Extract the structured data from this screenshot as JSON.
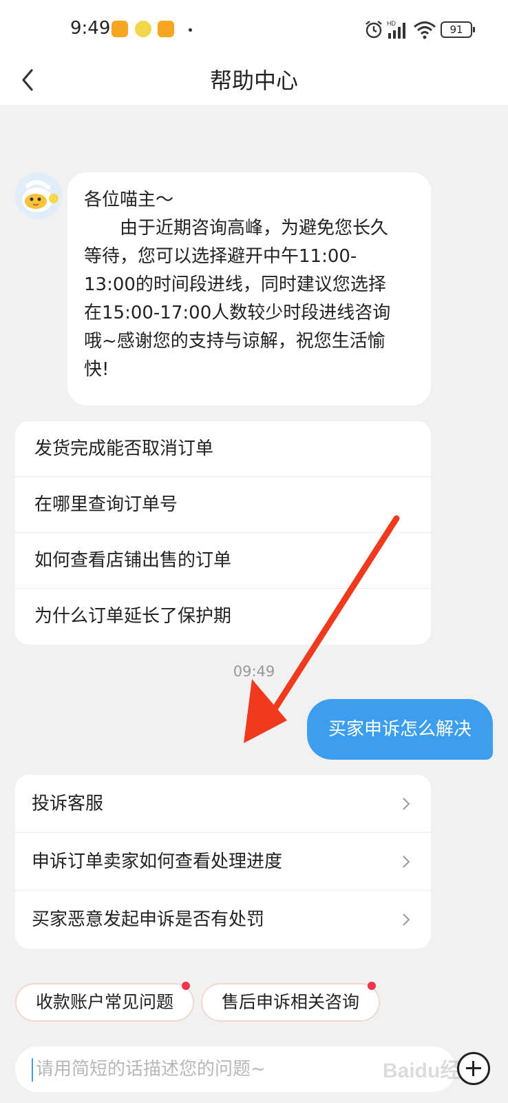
{
  "status_bar": {
    "time": "9:49",
    "battery": "91"
  },
  "header": {
    "title": "帮助中心"
  },
  "bot_message": {
    "lines": [
      "各位喵主～",
      "　　由于近期咨询高峰，为避免您长久",
      "等待，您可以选择避开中午11:00-",
      "13:00的时间段进线，同时建议您选择",
      "在15:00-17:00人数较少时段进线咨询",
      "哦~感谢您的支持与谅解，祝您生活愉",
      "快!"
    ]
  },
  "faq_card": {
    "items": [
      "发货完成能否取消订单",
      "在哪里查询订单号",
      "如何查看店铺出售的订单",
      "为什么订单延长了保护期"
    ]
  },
  "timestamp": "09:49",
  "user_message": "买家申诉怎么解决",
  "answer_card": {
    "items": [
      "投诉客服",
      "申诉订单卖家如何查看处理进度",
      "买家恶意发起申诉是否有处罚"
    ]
  },
  "chips": [
    "收款账户常见问题",
    "售后申诉相关咨询"
  ],
  "input": {
    "placeholder": "请用简短的话描述您的问题~"
  },
  "watermark": "Baidu经验",
  "colors": {
    "accent_blue": "#3d9ef0",
    "annotation_red": "#ef3a1d",
    "badge_red": "#f0354a"
  }
}
